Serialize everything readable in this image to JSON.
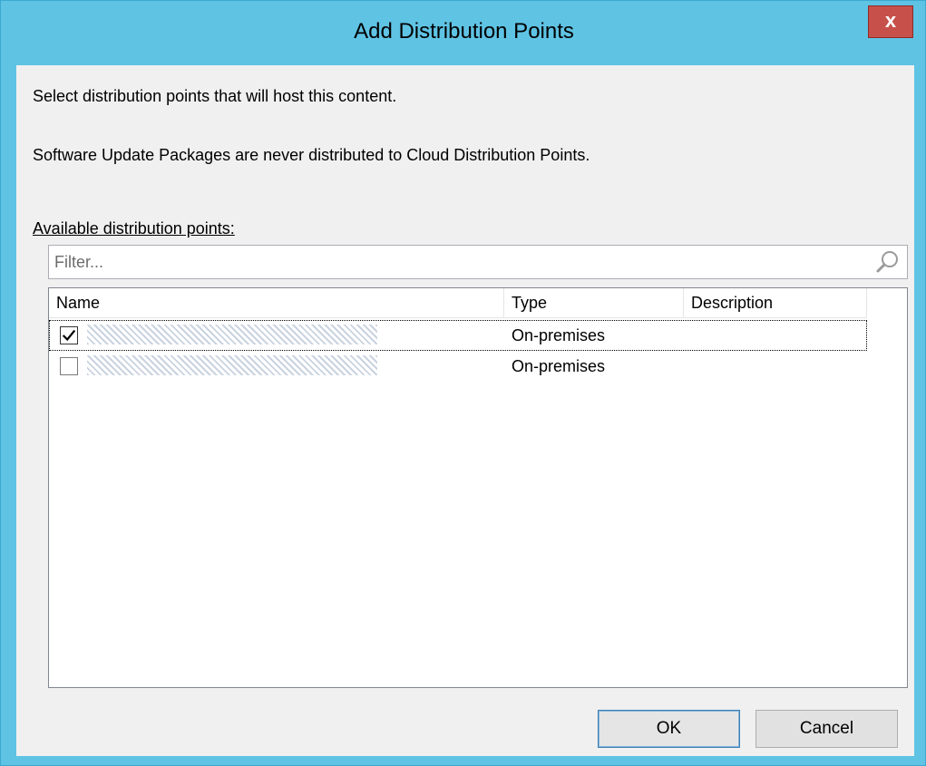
{
  "dialog": {
    "title": "Add Distribution Points",
    "close_label": "x",
    "instruction": "Select distribution points that will host this content.",
    "note": "Software Update Packages are never distributed to Cloud Distribution Points.",
    "list_label": "Available distribution points:",
    "filter": {
      "placeholder": "Filter...",
      "value": ""
    },
    "columns": [
      "Name",
      "Type",
      "Description"
    ],
    "rows": [
      {
        "checked": true,
        "type": "On-premises",
        "description": ""
      },
      {
        "checked": false,
        "type": "On-premises",
        "description": ""
      }
    ],
    "ok_label": "OK",
    "cancel_label": "Cancel"
  },
  "colors": {
    "titlebar": "#5fc3e4",
    "close": "#c7504a",
    "client": "#f0f0f0"
  },
  "icons": [
    "close-icon",
    "search-icon",
    "checkmark-icon"
  ]
}
